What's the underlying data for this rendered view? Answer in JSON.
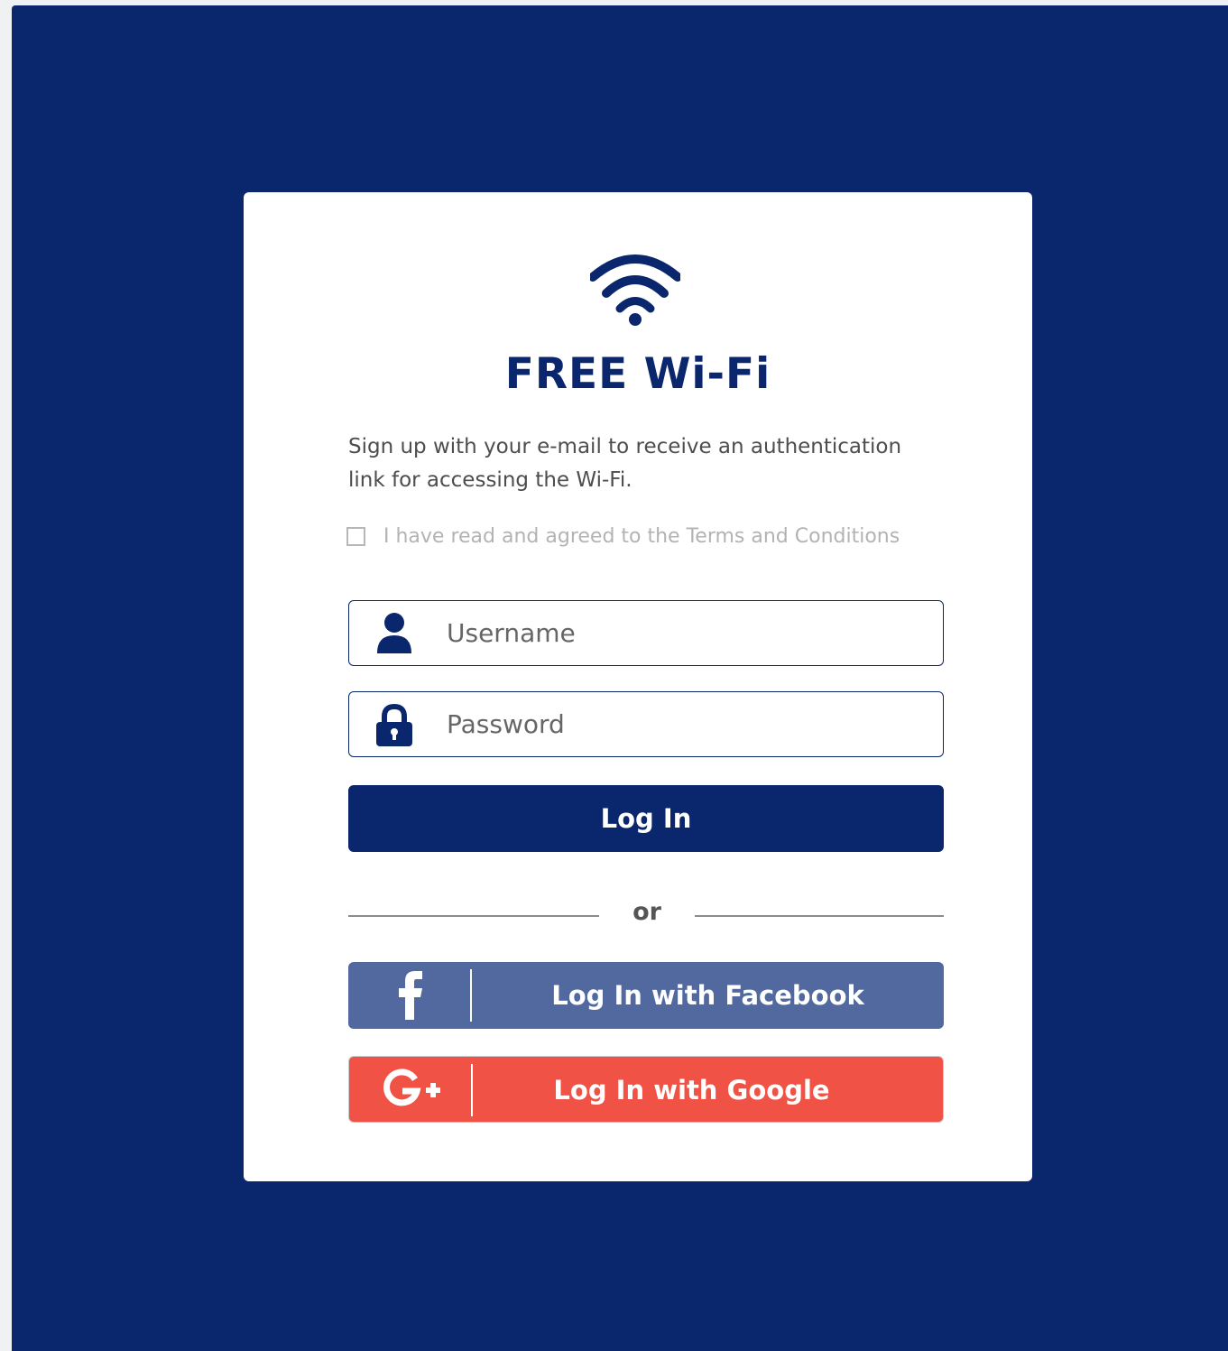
{
  "title": "FREE Wi-Fi",
  "subtitle": "Sign up with your e-mail to receive an authentication link for accessing the Wi-Fi.",
  "terms": {
    "label": "I have read and agreed to the Terms and Conditions",
    "checked": false
  },
  "username": {
    "placeholder": "Username",
    "value": "",
    "icon": "user-icon"
  },
  "password": {
    "placeholder": "Password",
    "value": "",
    "icon": "lock-icon"
  },
  "login_button": "Log In",
  "divider": "or",
  "facebook": {
    "label": "Log In with Facebook",
    "icon": "facebook-icon",
    "color": "#5269a0"
  },
  "google": {
    "label": "Log In with Google",
    "icon": "google-plus-icon",
    "color": "#f05345"
  },
  "colors": {
    "brand": "#0a266c",
    "card": "#ffffff",
    "text": "#4d4d4d",
    "muted": "#b3b3b3"
  }
}
